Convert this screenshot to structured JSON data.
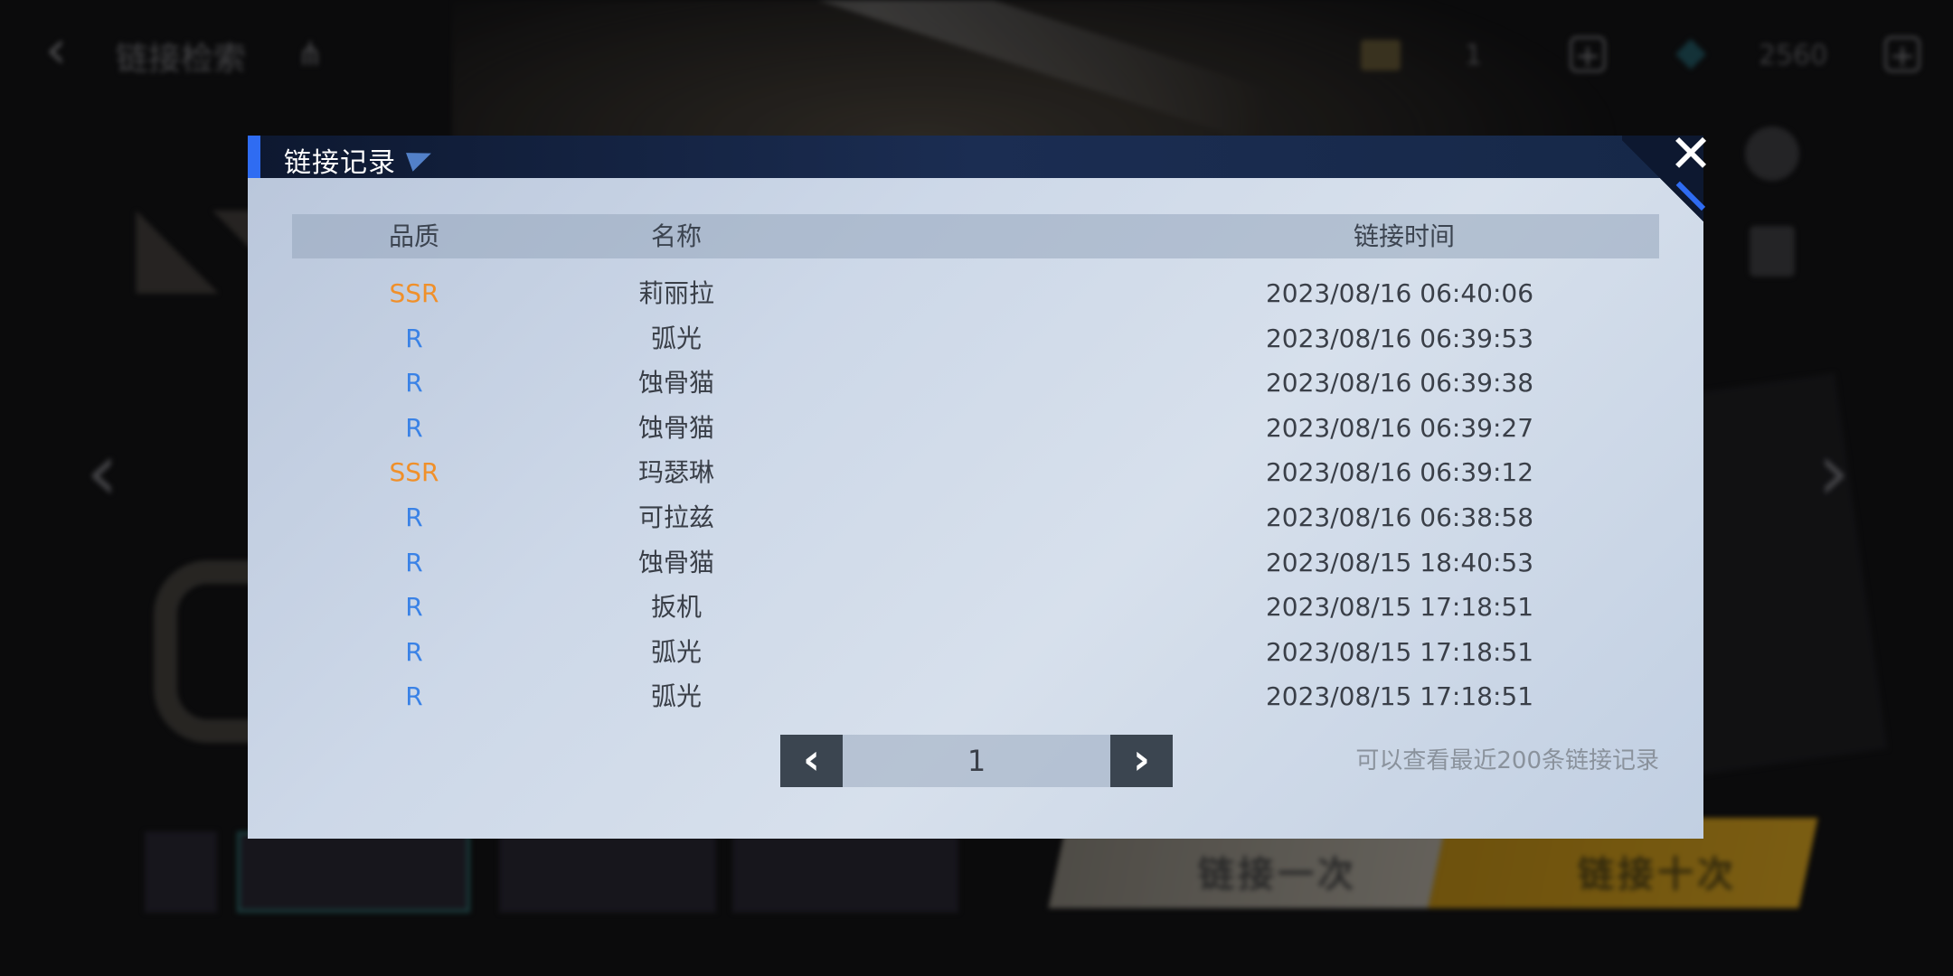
{
  "background": {
    "topbar_title": "链接检索",
    "ticket_count": "1",
    "gem_count": "2560",
    "pull_once_label": "链接一次",
    "pull_ten_label": "链接十次"
  },
  "dialog": {
    "title": "链接记录",
    "close_glyph": "✕",
    "columns": {
      "quality": "品质",
      "name": "名称",
      "time": "链接时间"
    },
    "rows": [
      {
        "quality": "SSR",
        "name": "莉丽拉",
        "time": "2023/08/16 06:40:06"
      },
      {
        "quality": "R",
        "name": "弧光",
        "time": "2023/08/16 06:39:53"
      },
      {
        "quality": "R",
        "name": "蚀骨猫",
        "time": "2023/08/16 06:39:38"
      },
      {
        "quality": "R",
        "name": "蚀骨猫",
        "time": "2023/08/16 06:39:27"
      },
      {
        "quality": "SSR",
        "name": "玛瑟琳",
        "time": "2023/08/16 06:39:12"
      },
      {
        "quality": "R",
        "name": "可拉兹",
        "time": "2023/08/16 06:38:58"
      },
      {
        "quality": "R",
        "name": "蚀骨猫",
        "time": "2023/08/15 18:40:53"
      },
      {
        "quality": "R",
        "name": "扳机",
        "time": "2023/08/15 17:18:51"
      },
      {
        "quality": "R",
        "name": "弧光",
        "time": "2023/08/15 17:18:51"
      },
      {
        "quality": "R",
        "name": "弧光",
        "time": "2023/08/15 17:18:51"
      }
    ],
    "pager": {
      "prev_glyph": "‹",
      "next_glyph": "›",
      "page": "1"
    },
    "hint": "可以查看最近200条链接记录"
  },
  "colors": {
    "SSR": "#f0902a",
    "R": "#3a82e6",
    "header_accent": "#2f6cf2"
  }
}
